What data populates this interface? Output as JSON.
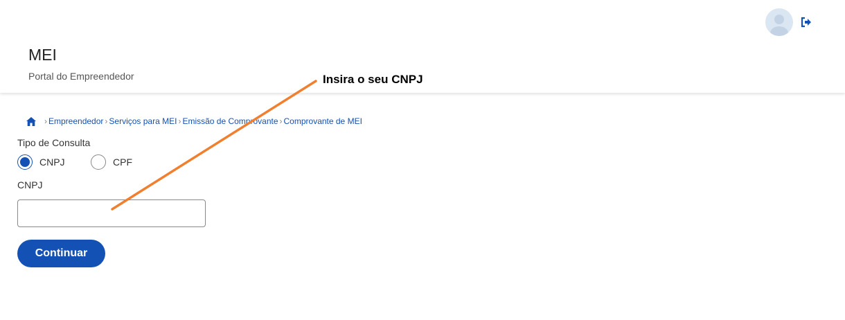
{
  "header": {
    "title": "MEI",
    "subtitle": "Portal do Empreendedor",
    "avatar_icon": "user-avatar",
    "logout_icon": "sign-out-icon"
  },
  "breadcrumb": {
    "home_icon": "home-icon",
    "items": [
      "Empreendedor",
      "Serviços para MEI",
      "Emissão de Comprovante",
      "Comprovante de MEI"
    ]
  },
  "form": {
    "tipo_label": "Tipo de Consulta",
    "options": [
      {
        "label": "CNPJ",
        "selected": true
      },
      {
        "label": "CPF",
        "selected": false
      }
    ],
    "cnpj_label": "CNPJ",
    "cnpj_value": "",
    "submit_label": "Continuar"
  },
  "annotation": {
    "text": "Insira o seu CNPJ",
    "color": "#f08030"
  },
  "colors": {
    "primary": "#1351b4",
    "annotation": "#f08030"
  }
}
